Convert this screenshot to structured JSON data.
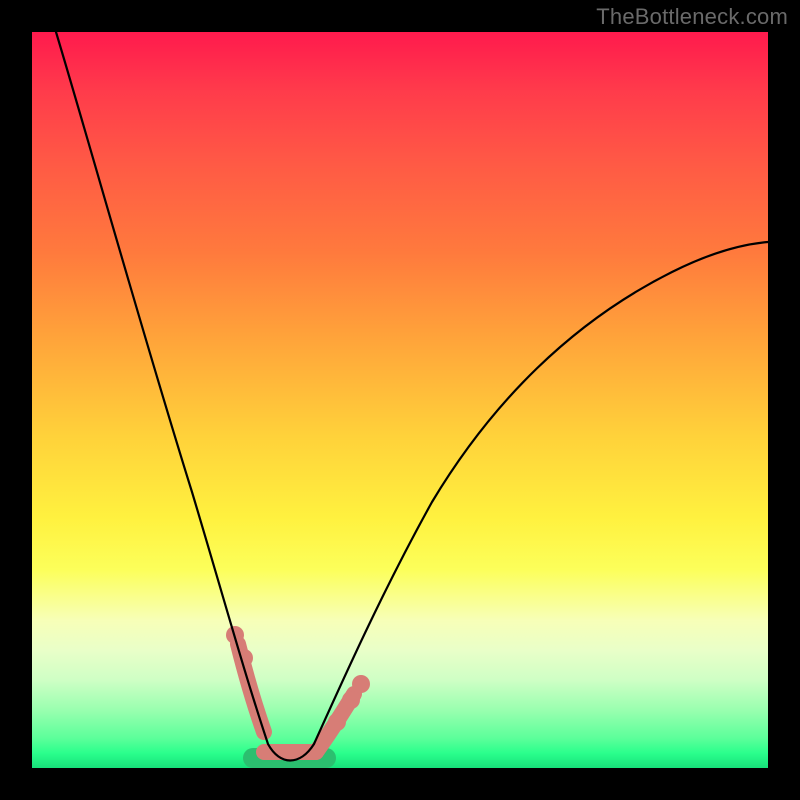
{
  "watermark": "TheBottleneck.com",
  "colors": {
    "curve": "#000000",
    "green_band": "#2bbf6f",
    "pink_band": "#d77d76",
    "gradient_top": "#ff1a4d",
    "gradient_bottom": "#17e07a",
    "frame": "#000000"
  },
  "chart_data": {
    "type": "line",
    "title": "",
    "xlabel": "",
    "ylabel": "",
    "xlim": [
      0,
      100
    ],
    "ylim": [
      0,
      100
    ],
    "grid": false,
    "legend": false,
    "series": [
      {
        "name": "curve",
        "x": [
          3,
          6,
          9,
          12,
          15,
          18,
          21,
          24,
          27,
          30,
          31.5,
          33,
          34.5,
          36,
          38,
          40,
          43,
          47,
          52,
          58,
          65,
          72,
          80,
          90,
          100
        ],
        "y": [
          100,
          90,
          79,
          68,
          58,
          48,
          38,
          29,
          20,
          12,
          8,
          4,
          1,
          0,
          0,
          1,
          4,
          10,
          18,
          27,
          36,
          44,
          52,
          61,
          70
        ]
      }
    ],
    "optimal_band": {
      "name": "optimal-range",
      "x_start": 30,
      "x_end": 40
    },
    "highlight_segments": [
      {
        "name": "pink-left",
        "x_start": 27.5,
        "x_end": 30
      },
      {
        "name": "pink-flat",
        "x_start": 30,
        "x_end": 40
      },
      {
        "name": "pink-right",
        "x_start": 40,
        "x_end": 44
      }
    ],
    "highlight_dots": [
      {
        "x": 27.5,
        "y": 17
      },
      {
        "x": 28.8,
        "y": 14
      },
      {
        "x": 41.5,
        "y": 5
      },
      {
        "x": 43.5,
        "y": 8
      },
      {
        "x": 44.5,
        "y": 10
      }
    ]
  }
}
